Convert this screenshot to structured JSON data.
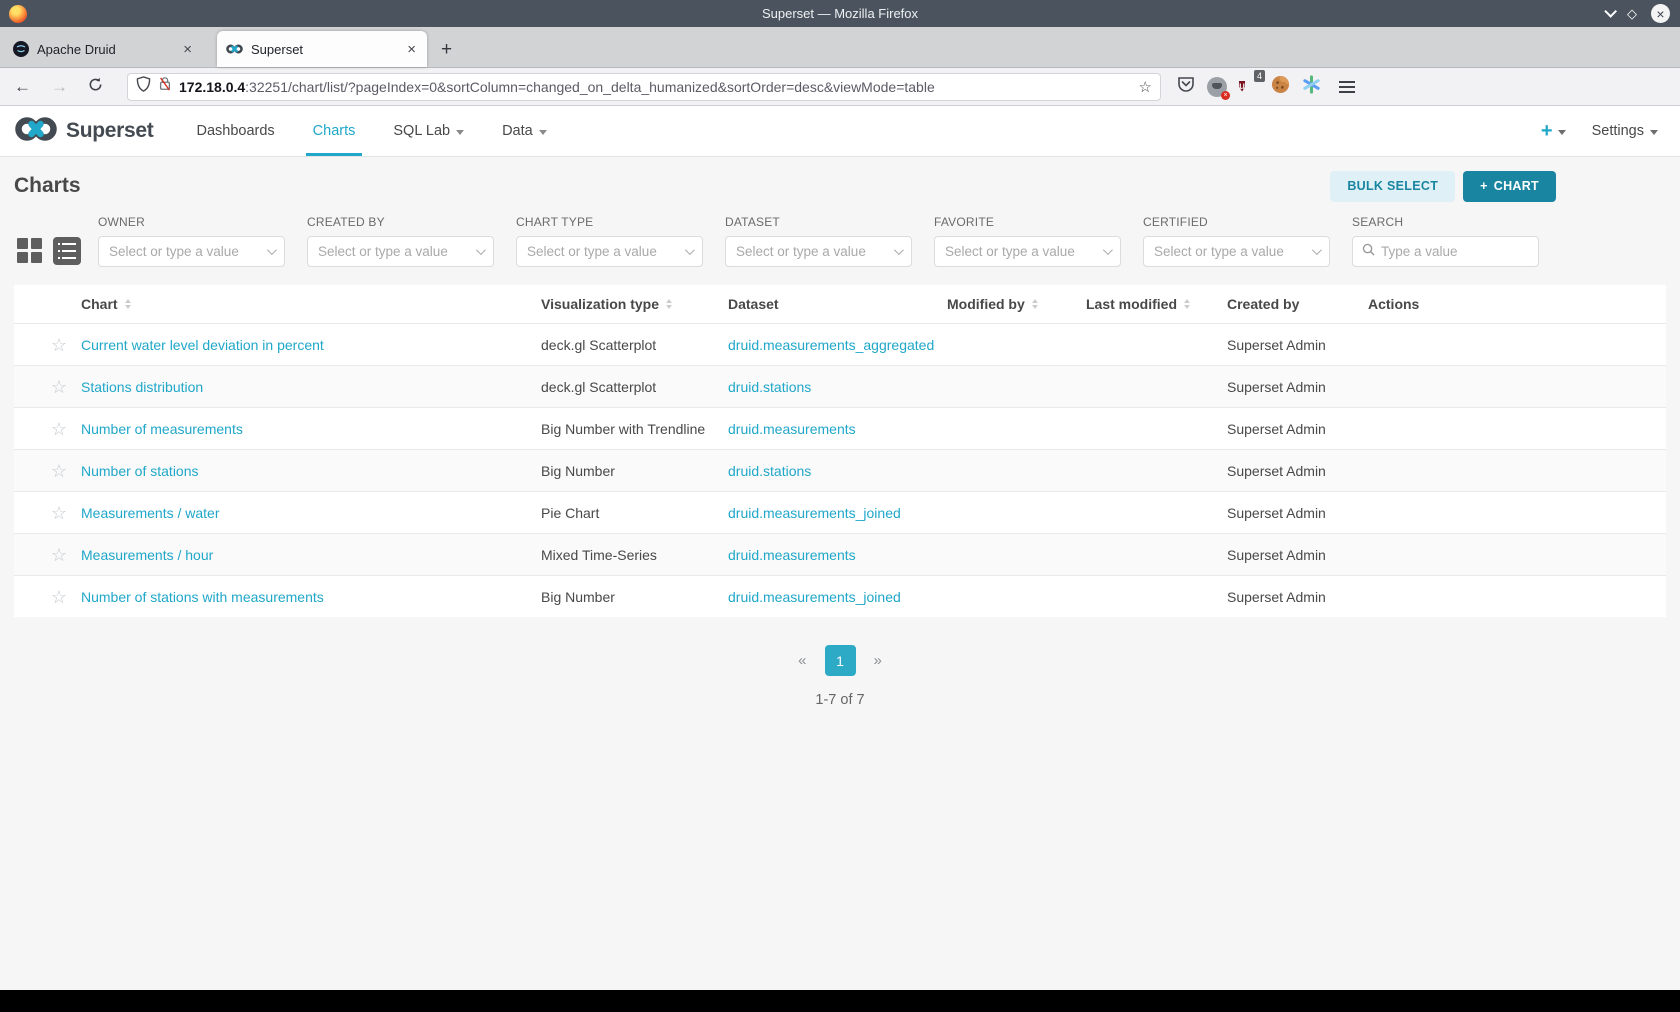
{
  "window": {
    "title": "Superset — Mozilla Firefox"
  },
  "glyphs": {
    "close": "×",
    "new_tab": "+",
    "back": "←",
    "forward": "→",
    "bookmark_star": "☆",
    "maximize_diamond": "◇",
    "fav_star": "☆",
    "prev": "«",
    "next": "»",
    "plus": "+",
    "ublock_u": "u"
  },
  "browser": {
    "tabs": [
      {
        "title": "Apache Druid"
      },
      {
        "title": "Superset"
      }
    ],
    "url_host": "172.18.0.4",
    "url_rest": ":32251/chart/list/?pageIndex=0&sortColumn=changed_on_delta_humanized&sortOrder=desc&viewMode=table",
    "shield_badge": "4"
  },
  "navbar": {
    "brand": "Superset",
    "items": [
      {
        "label": "Dashboards"
      },
      {
        "label": "Charts"
      },
      {
        "label": "SQL Lab"
      },
      {
        "label": "Data"
      }
    ],
    "settings_label": "Settings"
  },
  "page": {
    "title": "Charts",
    "bulk_select_label": "BULK SELECT",
    "new_chart_label": "CHART"
  },
  "filters": {
    "owner": {
      "label": "OWNER",
      "placeholder": "Select or type a value"
    },
    "created_by": {
      "label": "CREATED BY",
      "placeholder": "Select or type a value"
    },
    "chart_type": {
      "label": "CHART TYPE",
      "placeholder": "Select or type a value"
    },
    "dataset": {
      "label": "DATASET",
      "placeholder": "Select or type a value"
    },
    "favorite": {
      "label": "FAVORITE",
      "placeholder": "Select or type a value"
    },
    "certified": {
      "label": "CERTIFIED",
      "placeholder": "Select or type a value"
    },
    "search": {
      "label": "SEARCH",
      "placeholder": "Type a value"
    }
  },
  "table": {
    "columns": {
      "chart": "Chart",
      "viz": "Visualization type",
      "dataset": "Dataset",
      "modified_by": "Modified by",
      "last_modified": "Last modified",
      "created_by": "Created by",
      "actions": "Actions"
    },
    "rows": [
      {
        "chart": "Current water level deviation in percent",
        "viz": "deck.gl Scatterplot",
        "dataset": "druid.measurements_aggregated",
        "modified_by": "",
        "last_modified": "",
        "created_by": "Superset Admin"
      },
      {
        "chart": "Stations distribution",
        "viz": "deck.gl Scatterplot",
        "dataset": "druid.stations",
        "modified_by": "",
        "last_modified": "",
        "created_by": "Superset Admin"
      },
      {
        "chart": "Number of measurements",
        "viz": "Big Number with Trendline",
        "dataset": "druid.measurements",
        "modified_by": "",
        "last_modified": "",
        "created_by": "Superset Admin"
      },
      {
        "chart": "Number of stations",
        "viz": "Big Number",
        "dataset": "druid.stations",
        "modified_by": "",
        "last_modified": "",
        "created_by": "Superset Admin"
      },
      {
        "chart": "Measurements / water",
        "viz": "Pie Chart",
        "dataset": "druid.measurements_joined",
        "modified_by": "",
        "last_modified": "",
        "created_by": "Superset Admin"
      },
      {
        "chart": "Measurements / hour",
        "viz": "Mixed Time-Series",
        "dataset": "druid.measurements",
        "modified_by": "",
        "last_modified": "",
        "created_by": "Superset Admin"
      },
      {
        "chart": "Number of stations with measurements",
        "viz": "Big Number",
        "dataset": "druid.measurements_joined",
        "modified_by": "",
        "last_modified": "",
        "created_by": "Superset Admin"
      }
    ]
  },
  "pagination": {
    "page": "1",
    "summary": "1-7 of 7"
  },
  "colors": {
    "accent": "#20a7c9",
    "accent_dark": "#1a85a0",
    "link": "#20a7c9",
    "titlebar": "#4b545e"
  }
}
